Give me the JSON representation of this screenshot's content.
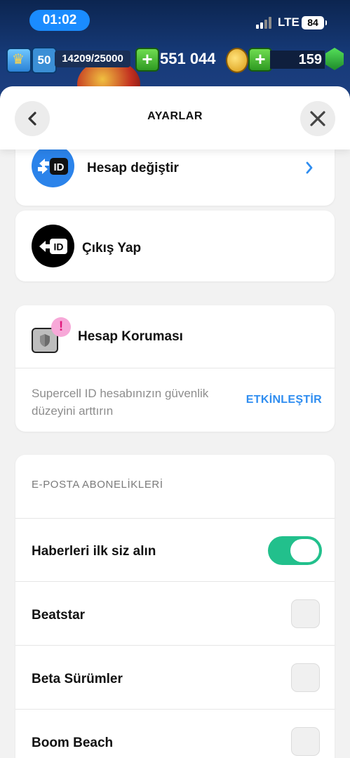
{
  "status_bar": {
    "time": "01:02",
    "network": "LTE",
    "battery": "84"
  },
  "game_hud": {
    "level": "50",
    "xp": "14209/25000",
    "gold": "551 044",
    "gems": "159"
  },
  "header": {
    "title": "AYARLAR"
  },
  "accounts": {
    "switch_label": "Hesap değiştir",
    "logout_label": "Çıkış Yap"
  },
  "protection": {
    "title": "Hesap Koruması",
    "alert": "!",
    "description": "Supercell ID hesabınızın güvenlik düzeyini arttırın",
    "action": "ETKİNLEŞTİR"
  },
  "subscriptions": {
    "title": "E-POSTA ABONELİKLERİ",
    "items": [
      {
        "label": "Haberleri ilk siz alın",
        "control": "toggle",
        "enabled": true
      },
      {
        "label": "Beatstar",
        "control": "checkbox",
        "checked": false
      },
      {
        "label": "Beta Sürümler",
        "control": "checkbox",
        "checked": false
      },
      {
        "label": "Boom Beach",
        "control": "checkbox",
        "checked": false
      }
    ]
  },
  "colors": {
    "accent": "#2f8df0",
    "toggle_on": "#22c08c",
    "id_blue": "#2b83ea",
    "alert_pink": "#f7a8d8"
  }
}
